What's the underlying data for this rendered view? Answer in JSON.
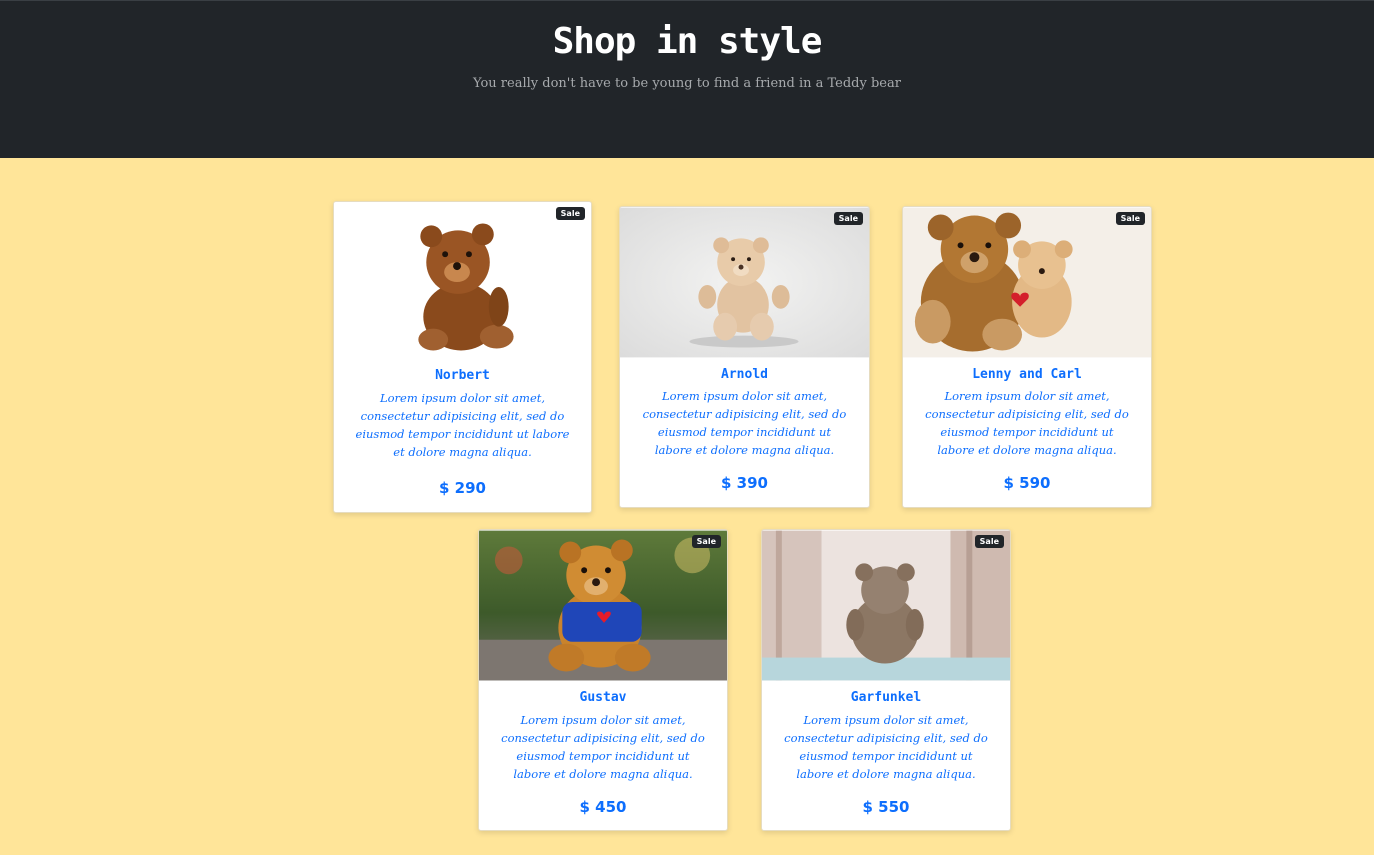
{
  "header": {
    "title": "Shop in style",
    "subtitle": "You really don't have to be young to find a friend in a Teddy bear"
  },
  "products": [
    {
      "name": "Norbert",
      "badge": "Sale",
      "description": "Lorem ipsum dolor sit amet, consectetur adipisicing elit, sed do eiusmod tempor incididunt ut labore et dolore magna aliqua.",
      "price": "$ 290"
    },
    {
      "name": "Arnold",
      "badge": "Sale",
      "description": "Lorem ipsum dolor sit amet, consectetur adipisicing elit, sed do eiusmod tempor incididunt ut labore et dolore magna aliqua.",
      "price": "$ 390"
    },
    {
      "name": "Lenny and Carl",
      "badge": "Sale",
      "description": "Lorem ipsum dolor sit amet, consectetur adipisicing elit, sed do eiusmod tempor incididunt ut labore et dolore magna aliqua.",
      "price": "$ 590"
    },
    {
      "name": "Gustav",
      "badge": "Sale",
      "description": "Lorem ipsum dolor sit amet, consectetur adipisicing elit, sed do eiusmod tempor incididunt ut labore et dolore magna aliqua.",
      "price": "$ 450"
    },
    {
      "name": "Garfunkel",
      "badge": "Sale",
      "description": "Lorem ipsum dolor sit amet, consectetur adipisicing elit, sed do eiusmod tempor incididunt ut labore et dolore magna aliqua.",
      "price": "$ 550"
    }
  ],
  "colors": {
    "header_bg": "#212529",
    "page_bg": "#ffe599",
    "accent": "#0d6efd",
    "badge_bg": "#212529"
  }
}
